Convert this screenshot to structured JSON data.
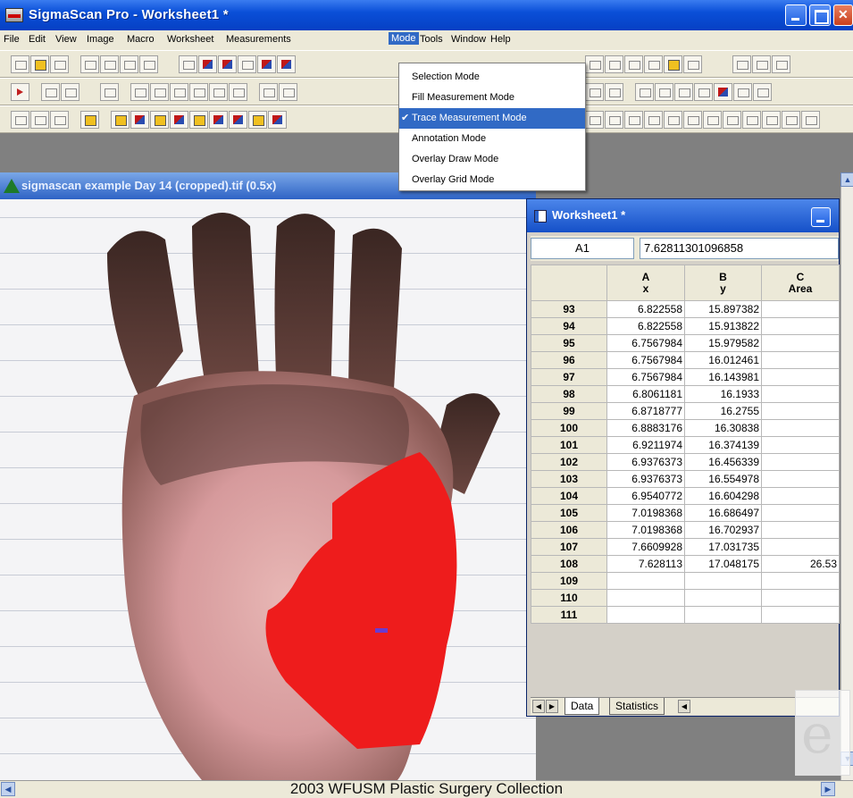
{
  "app": {
    "title": "SigmaScan Pro - Worksheet1 *"
  },
  "menu": {
    "items": [
      "File",
      "Edit",
      "View",
      "Image",
      "Macro",
      "Worksheet",
      "Measurements",
      "Mode",
      "Tools",
      "Window",
      "Help"
    ]
  },
  "mode_menu": {
    "items": [
      {
        "label": "Selection Mode",
        "checked": false
      },
      {
        "label": "Fill Measurement Mode",
        "checked": false
      },
      {
        "label": "Trace Measurement Mode",
        "checked": true
      },
      {
        "label": "Annotation Mode",
        "checked": false
      },
      {
        "label": "Overlay Draw Mode",
        "checked": false
      },
      {
        "label": "Overlay Grid Mode",
        "checked": false
      }
    ]
  },
  "image_window": {
    "title": "sigmascan example Day 14 (cropped).tif (0.5x)"
  },
  "worksheet": {
    "title": "Worksheet1 *",
    "cell_ref": "A1",
    "cell_value": "7.62811301096858",
    "columns": [
      {
        "letter": "A",
        "name": "x"
      },
      {
        "letter": "B",
        "name": "y"
      },
      {
        "letter": "C",
        "name": "Area"
      }
    ],
    "rows": [
      {
        "n": "93",
        "a": "6.822558",
        "b": "15.897382",
        "c": ""
      },
      {
        "n": "94",
        "a": "6.822558",
        "b": "15.913822",
        "c": ""
      },
      {
        "n": "95",
        "a": "6.7567984",
        "b": "15.979582",
        "c": ""
      },
      {
        "n": "96",
        "a": "6.7567984",
        "b": "16.012461",
        "c": ""
      },
      {
        "n": "97",
        "a": "6.7567984",
        "b": "16.143981",
        "c": ""
      },
      {
        "n": "98",
        "a": "6.8061181",
        "b": "16.1933",
        "c": ""
      },
      {
        "n": "99",
        "a": "6.8718777",
        "b": "16.2755",
        "c": ""
      },
      {
        "n": "100",
        "a": "6.8883176",
        "b": "16.30838",
        "c": ""
      },
      {
        "n": "101",
        "a": "6.9211974",
        "b": "16.374139",
        "c": ""
      },
      {
        "n": "102",
        "a": "6.9376373",
        "b": "16.456339",
        "c": ""
      },
      {
        "n": "103",
        "a": "6.9376373",
        "b": "16.554978",
        "c": ""
      },
      {
        "n": "104",
        "a": "6.9540772",
        "b": "16.604298",
        "c": ""
      },
      {
        "n": "105",
        "a": "7.0198368",
        "b": "16.686497",
        "c": ""
      },
      {
        "n": "106",
        "a": "7.0198368",
        "b": "16.702937",
        "c": ""
      },
      {
        "n": "107",
        "a": "7.6609928",
        "b": "17.031735",
        "c": ""
      },
      {
        "n": "108",
        "a": "7.628113",
        "b": "17.048175",
        "c": "26.53"
      },
      {
        "n": "109",
        "a": "",
        "b": "",
        "c": ""
      },
      {
        "n": "110",
        "a": "",
        "b": "",
        "c": ""
      },
      {
        "n": "111",
        "a": "",
        "b": "",
        "c": ""
      }
    ],
    "tabs": [
      "Data",
      "Statistics"
    ]
  },
  "caption": "2003 WFUSM Plastic Surgery Collection",
  "watermark": "e",
  "colors": {
    "trace_fill": "#ee1c1c",
    "highlight": "#316ac5"
  }
}
